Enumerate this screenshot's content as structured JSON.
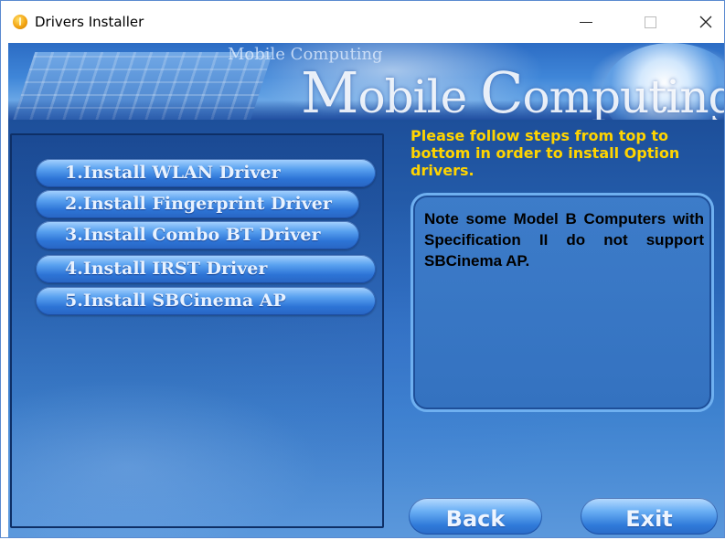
{
  "window": {
    "title": "Drivers Installer",
    "icon": "info-circle-icon",
    "controls": {
      "minimize": "minimize-icon",
      "maximize": "maximize-icon",
      "close": "close-icon"
    }
  },
  "banner": {
    "small_title": "Mobile Computing",
    "big_title_cap1": "M",
    "big_title_rest1": "obile ",
    "big_title_cap2": "C",
    "big_title_rest2": "omputing"
  },
  "install_buttons": [
    {
      "label": "1.Install WLAN Driver"
    },
    {
      "label": "2.Install Fingerprint Driver"
    },
    {
      "label": "3.Install Combo BT Driver"
    },
    {
      "label": "4.Install IRST Driver"
    },
    {
      "label": "5.Install SBCinema AP"
    }
  ],
  "instructions": "Please follow steps from top to bottom in order to install Option drivers.",
  "note": "Note some Model B Computers with Specification II do not support SBCinema AP.",
  "nav": {
    "back": "Back",
    "exit": "Exit"
  },
  "colors": {
    "instruction_text": "#ffd400",
    "accent_blue": "#2d74d6"
  }
}
